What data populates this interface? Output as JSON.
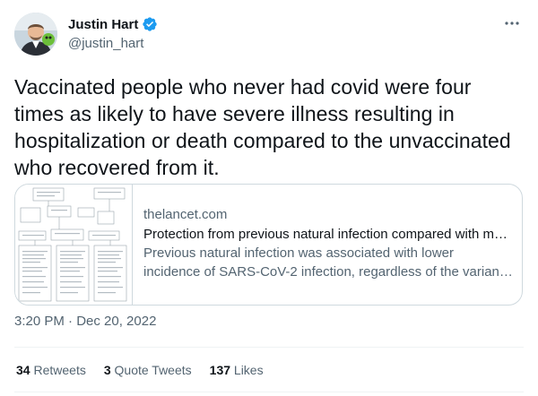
{
  "author": {
    "display_name": "Justin Hart",
    "handle": "@justin_hart"
  },
  "tweet": {
    "text": "Vaccinated people who never had covid were four times as likely to have severe illness resulting in hospitalization or death compared to the unvaccinated who recovered from it."
  },
  "card": {
    "domain": "thelancet.com",
    "title": "Protection from previous natural infection compared with m…",
    "description_line1": "Previous natural infection was associated with lower",
    "description_line2": "incidence of SARS-CoV-2 infection, regardless of the varian…"
  },
  "timestamp": "3:20 PM · Dec 20, 2022",
  "stats": {
    "retweets_count": "34",
    "retweets_label": "Retweets",
    "quotes_count": "3",
    "quotes_label": "Quote Tweets",
    "likes_count": "137",
    "likes_label": "Likes"
  },
  "colors": {
    "verified": "#1d9bf0",
    "secondary_text": "#536471",
    "primary_text": "#0f1419",
    "border": "#cfd9de"
  },
  "icons": {
    "verified": "verified-badge-icon",
    "more": "more-horizontal-icon"
  }
}
